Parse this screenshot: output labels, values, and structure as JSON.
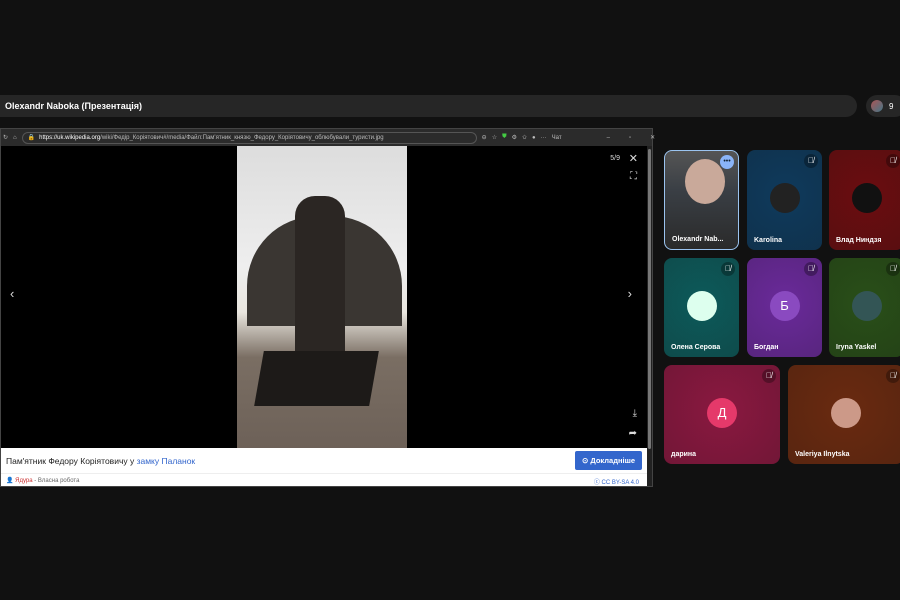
{
  "meeting": {
    "presenter_title": "Olexandr Naboka (Презентація)",
    "participant_count": "9"
  },
  "browser": {
    "url_host": "https://uk.wikipedia.org",
    "url_path": "/wiki/Федір_Коріятович#/media/Файл:Пам'ятник_князю_Федору_Коріятовичу_облюбували_туристи.jpg",
    "chat_label": "Чат"
  },
  "viewer": {
    "counter": "5/9",
    "caption_text": "Пам'ятник Федору Коріятовичу у ",
    "caption_link": "замку Паланок",
    "more_button": "Докладніше",
    "author": "Ядура",
    "author_suffix": " - Власна робота",
    "license": "CC BY-SA 4.0"
  },
  "participants": [
    {
      "name": "Olexandr Nab...",
      "color": "#3a3f45"
    },
    {
      "name": "Karolina",
      "color": "#0f3a5c"
    },
    {
      "name": "Влад Ниндзя",
      "color": "#6b0d10"
    },
    {
      "name": "Олена Серова",
      "color": "#0d5a5a",
      "initial": ""
    },
    {
      "name": "Богдан",
      "color": "#6a2a9a",
      "initial": "Б"
    },
    {
      "name": "Iryna Yaskel",
      "color": "#294f18"
    },
    {
      "name": "дарина",
      "color": "#8a1840",
      "initial": "Д"
    },
    {
      "name": "Valeriya Ilnytska",
      "color": "#6a2a10"
    }
  ]
}
